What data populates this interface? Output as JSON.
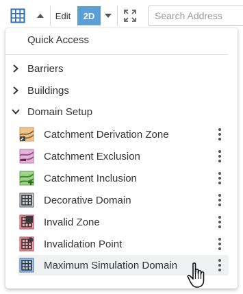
{
  "toolbar": {
    "layers_icon": "grid-icon",
    "edit_label": "Edit",
    "view_mode_label": "2D",
    "search_placeholder": "Search Address",
    "accent_color": "#5b9fd6"
  },
  "menu": {
    "quick_access_label": "Quick Access",
    "groups": [
      {
        "label": "Barriers",
        "expanded": false
      },
      {
        "label": "Buildings",
        "expanded": false
      },
      {
        "label": "Domain Setup",
        "expanded": true
      }
    ],
    "items": [
      {
        "label": "Catchment Derivation Zone",
        "icon": "catchment-derivation-icon"
      },
      {
        "label": "Catchment Exclusion",
        "icon": "catchment-exclusion-icon"
      },
      {
        "label": "Catchment Inclusion",
        "icon": "catchment-inclusion-icon"
      },
      {
        "label": "Decorative Domain",
        "icon": "decorative-domain-icon"
      },
      {
        "label": "Invalid Zone",
        "icon": "invalid-zone-icon"
      },
      {
        "label": "Invalidation Point",
        "icon": "invalidation-point-icon"
      },
      {
        "label": "Maximum Simulation Domain",
        "icon": "maximum-simulation-domain-icon",
        "hovered": true
      }
    ]
  }
}
